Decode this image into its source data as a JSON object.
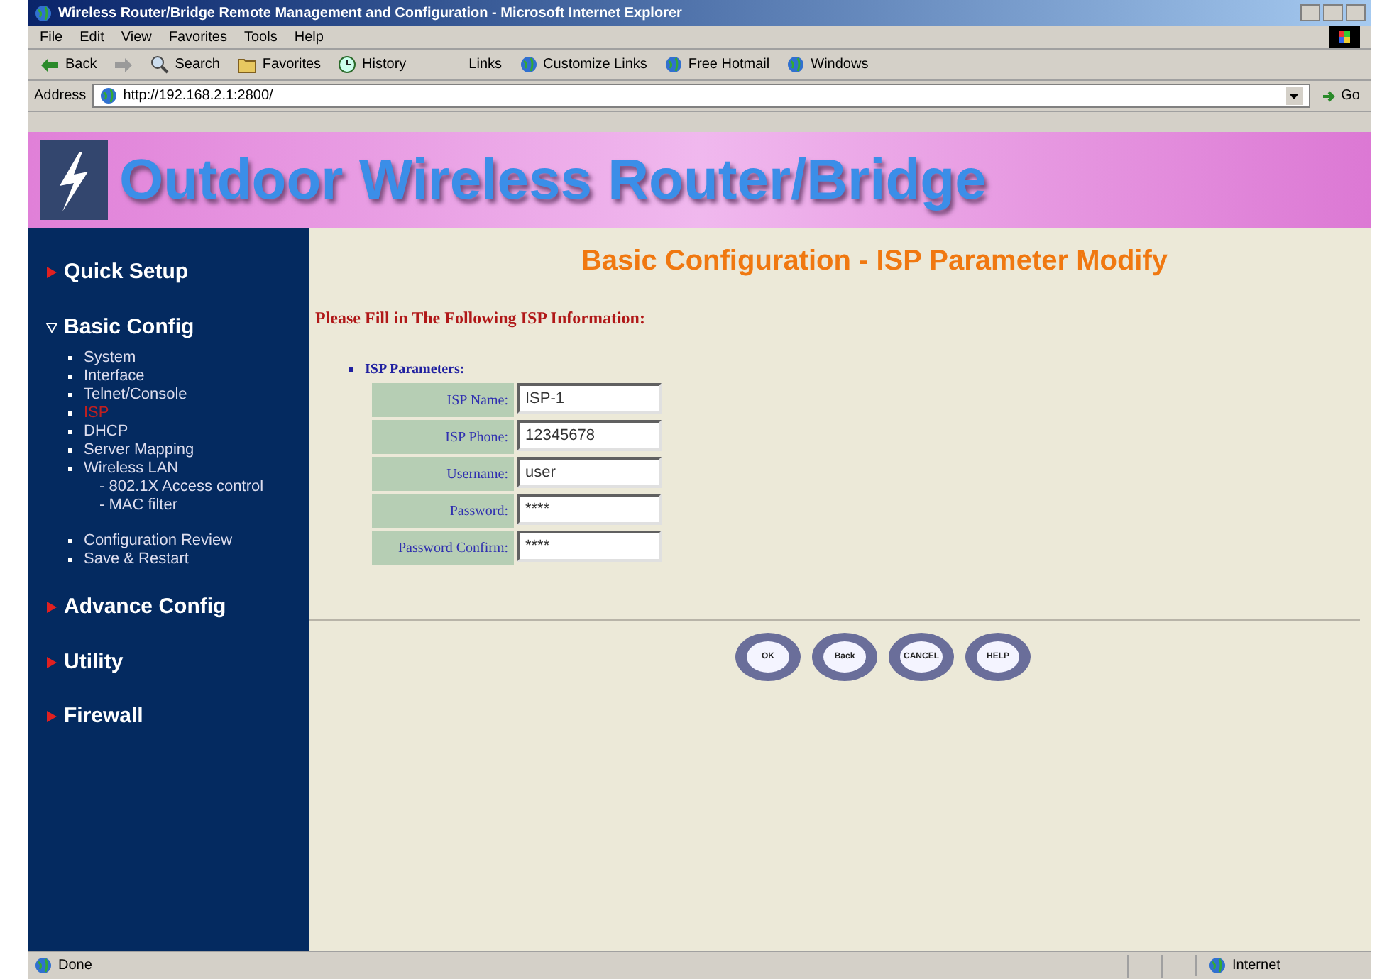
{
  "window": {
    "title": "Wireless Router/Bridge Remote Management and Configuration - Microsoft Internet Explorer"
  },
  "menu": [
    "File",
    "Edit",
    "View",
    "Favorites",
    "Tools",
    "Help"
  ],
  "toolbar": [
    {
      "label": "Back",
      "kind": "back"
    },
    {
      "kind": "forward"
    },
    {
      "label": "Search",
      "kind": "search"
    },
    {
      "label": "Favorites",
      "kind": "favorites"
    },
    {
      "label": "History",
      "kind": "history"
    }
  ],
  "links": {
    "label": "Links",
    "items": [
      "Customize Links",
      "Free Hotmail",
      "Windows"
    ]
  },
  "address": {
    "label": "Address",
    "value": "http://192.168.2.1:2800/",
    "go": "Go"
  },
  "banner": {
    "title": "Outdoor Wireless Router/Bridge"
  },
  "sidebar": [
    {
      "label": "Quick Setup",
      "expanded": false
    },
    {
      "label": "Basic Config",
      "expanded": true,
      "items": [
        {
          "label": "System",
          "selected": false
        },
        {
          "label": "Interface",
          "selected": false
        },
        {
          "label": "Telnet/Console",
          "selected": false
        },
        {
          "label": "ISP",
          "selected": true
        },
        {
          "label": "DHCP",
          "selected": false
        },
        {
          "label": "Server Mapping",
          "selected": false
        },
        {
          "label": "Wireless LAN",
          "selected": false,
          "children": [
            {
              "label": "- 802.1X Access control",
              "selected": false
            },
            {
              "label": "- MAC filter",
              "selected": false
            }
          ]
        },
        {
          "label": "Configuration Review",
          "selected": false
        },
        {
          "label": "Save & Restart",
          "selected": false
        }
      ]
    },
    {
      "label": "Advance Config",
      "expanded": false
    },
    {
      "label": "Utility",
      "expanded": false
    },
    {
      "label": "Firewall",
      "expanded": false
    }
  ],
  "page": {
    "title": "Basic Configuration - ISP Parameter Modify",
    "instruction": "Please Fill in The Following ISP Information:",
    "section": "ISP Parameters:",
    "fields": [
      {
        "label": "ISP Name:",
        "value": "ISP-1"
      },
      {
        "label": "ISP Phone:",
        "value": "12345678"
      },
      {
        "label": "Username:",
        "value": "user"
      },
      {
        "label": "Password:",
        "value": "****"
      },
      {
        "label": "Password Confirm:",
        "value": "****"
      }
    ],
    "buttons": [
      "OK",
      "Back",
      "CANCEL",
      "HELP"
    ]
  },
  "status_bar": {
    "text": "Done",
    "zone": "Internet"
  }
}
